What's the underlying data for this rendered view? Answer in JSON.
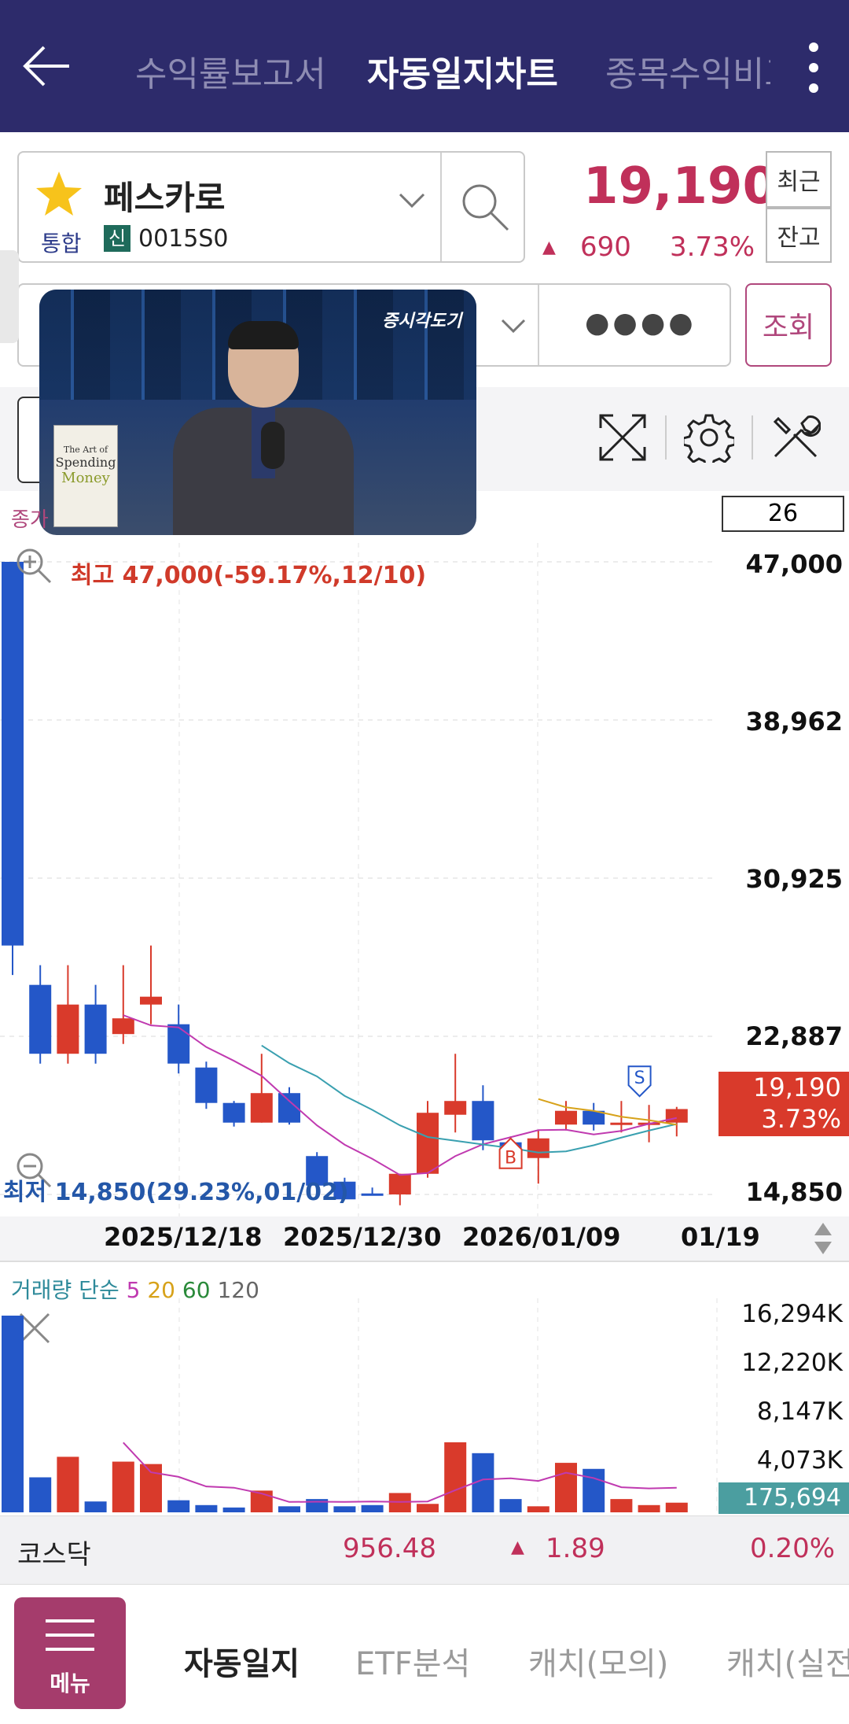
{
  "header": {
    "tabs": [
      {
        "label": "수익률보고서",
        "active": false
      },
      {
        "label": "자동일지차트",
        "active": true
      },
      {
        "label": "종목수익비교",
        "active": false
      }
    ]
  },
  "stock": {
    "name": "페스카로",
    "market": "통합",
    "badge": "신",
    "code": "0015S0",
    "price": "19,190",
    "change": "690",
    "change_pct": "3.73%",
    "btn_recent": "최근",
    "btn_balance": "잔고",
    "password_mask": "●●●●",
    "btn_query": "조회"
  },
  "video": {
    "logo_text": "증시각도기",
    "book_title_1": "The Art of",
    "book_title_2": "Spending",
    "book_title_3": "Money"
  },
  "chart": {
    "period_value": "26",
    "high_label": "최고 47,000(-59.17%,12/10)",
    "low_label": "최저 14,850(29.23%,01/02)",
    "current_price": "19,190",
    "current_pct": "3.73%",
    "marker_buy": "B",
    "marker_sell": "S",
    "legend_prefix": "종가"
  },
  "chart_data": {
    "type": "candlestick",
    "y_ticks": [
      "47,000",
      "38,962",
      "30,925",
      "22,887",
      "14,850"
    ],
    "ylim": [
      14850,
      47000
    ],
    "x_ticks": [
      "2025/12/18",
      "2025/12/30",
      "2026/01/09",
      "01/19"
    ],
    "candles": [
      {
        "o": 47000,
        "h": 47000,
        "l": 26000,
        "c": 27500,
        "color": "blue"
      },
      {
        "o": 25500,
        "h": 26500,
        "l": 21500,
        "c": 22000,
        "color": "blue"
      },
      {
        "o": 22000,
        "h": 26500,
        "l": 21500,
        "c": 24500,
        "color": "red"
      },
      {
        "o": 24500,
        "h": 25500,
        "l": 21500,
        "c": 22000,
        "color": "blue"
      },
      {
        "o": 23000,
        "h": 26500,
        "l": 22500,
        "c": 23800,
        "color": "red"
      },
      {
        "o": 24500,
        "h": 27500,
        "l": 23500,
        "c": 24900,
        "color": "red"
      },
      {
        "o": 23500,
        "h": 24500,
        "l": 21000,
        "c": 21500,
        "color": "blue"
      },
      {
        "o": 21300,
        "h": 21600,
        "l": 19200,
        "c": 19500,
        "color": "blue"
      },
      {
        "o": 19500,
        "h": 19600,
        "l": 18300,
        "c": 18500,
        "color": "blue"
      },
      {
        "o": 18500,
        "h": 22000,
        "l": 18500,
        "c": 20000,
        "color": "red"
      },
      {
        "o": 20000,
        "h": 20300,
        "l": 18400,
        "c": 18500,
        "color": "blue"
      },
      {
        "o": 16800,
        "h": 17000,
        "l": 15000,
        "c": 15300,
        "color": "blue"
      },
      {
        "o": 15500,
        "h": 15700,
        "l": 14900,
        "c": 14600,
        "color": "blue"
      },
      {
        "o": 14850,
        "h": 15200,
        "l": 14800,
        "c": 14900,
        "color": "blue"
      },
      {
        "o": 14850,
        "h": 15900,
        "l": 14300,
        "c": 15900,
        "color": "red"
      },
      {
        "o": 15900,
        "h": 19600,
        "l": 15700,
        "c": 19000,
        "color": "red"
      },
      {
        "o": 18900,
        "h": 22000,
        "l": 18000,
        "c": 19600,
        "color": "red"
      },
      {
        "o": 19600,
        "h": 20400,
        "l": 17100,
        "c": 17600,
        "color": "blue"
      },
      {
        "o": 17500,
        "h": 17800,
        "l": 16400,
        "c": 16700,
        "color": "blue"
      },
      {
        "o": 16700,
        "h": 18100,
        "l": 15400,
        "c": 17700,
        "color": "red"
      },
      {
        "o": 18400,
        "h": 19600,
        "l": 18100,
        "c": 19100,
        "color": "red"
      },
      {
        "o": 19100,
        "h": 19500,
        "l": 18100,
        "c": 18400,
        "color": "blue"
      },
      {
        "o": 18500,
        "h": 19600,
        "l": 18000,
        "c": 18500,
        "color": "red"
      },
      {
        "o": 18500,
        "h": 19400,
        "l": 17500,
        "c": 18500,
        "color": "red"
      },
      {
        "o": 18500,
        "h": 19300,
        "l": 17800,
        "c": 19190,
        "color": "red"
      }
    ]
  },
  "volume": {
    "legend_title": "거래량 단순",
    "ma_5": "5",
    "ma_20": "20",
    "ma_60": "60",
    "ma_120": "120",
    "y_ticks": [
      "16,294K",
      "12,220K",
      "8,147K",
      "4,073K"
    ],
    "current": "175,694",
    "values_k": [
      16294,
      2900,
      4600,
      900,
      4200,
      4000,
      1000,
      600,
      400,
      1800,
      500,
      1100,
      500,
      600,
      1600,
      700,
      5800,
      4900,
      1100,
      500,
      4100,
      3600,
      1100,
      600,
      800
    ]
  },
  "index": {
    "name": "코스닥",
    "value": "956.48",
    "change": "1.89",
    "change_pct": "0.20%"
  },
  "bottom": {
    "menu_label": "메뉴",
    "tabs": [
      "자동일지",
      "ETF분석",
      "캐치(모의)",
      "캐치(실전)"
    ]
  }
}
